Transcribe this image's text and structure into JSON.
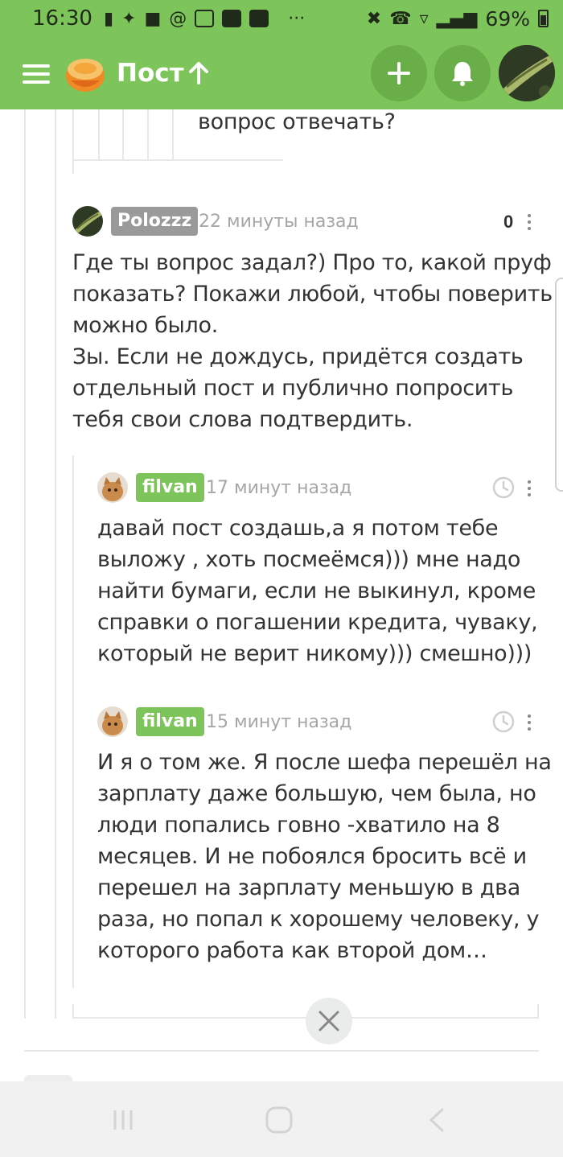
{
  "status_bar": {
    "time": "16:30",
    "overflow": "···",
    "battery": "69%"
  },
  "header": {
    "title": "Пост",
    "colors": {
      "brand": "#7dc55a",
      "button": "#6aae49"
    }
  },
  "top_fragment": {
    "text": "вопрос отвечать?"
  },
  "comments": [
    {
      "user": "Polozzz",
      "time": "22 минуты назад",
      "rating": "0",
      "text": "Где ты вопрос задал?) Про то, какой пруф\nпоказать? Покажи любой, чтобы поверить\nможно было.\nЗы. Если не дождусь, придётся создать\nотдельный пост и публично попросить\nтебя свои слова подтвердить."
    },
    {
      "user": "filvan",
      "time": "17 минут назад",
      "text": "давай пост создашь,а я потом тебе\nвыложу , хоть посмеёмся))) мне надо\nнайти бумаги, если не выкинул, кроме\nсправки о погашении кредита, чуваку,\nкоторый не верит никому))) смешно)))"
    },
    {
      "user": "filvan",
      "time": "15 минут назад",
      "text": "И я о том же. Я после шефа перешёл на\nзарплату даже большую, чем была, но\nлюди попались говно -хватило на 8\nмесяцев. И не побоялся бросить всё и\nперешел на зарплату меньшую в два\nраза, но попал к хорошему человеку, у\nкоторого работа как второй дом…"
    }
  ]
}
